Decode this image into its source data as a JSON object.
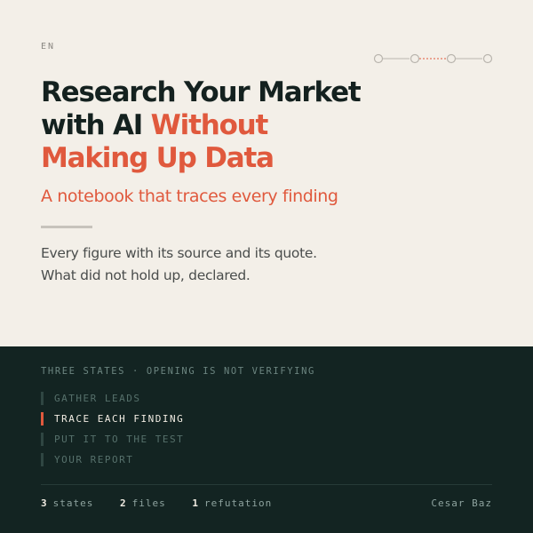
{
  "language": "EN",
  "title": {
    "line1": "Research Your Market",
    "line2_plain": "with AI ",
    "line2_accent": "Without",
    "line3_accent": "Making Up Data"
  },
  "subtitle": "A notebook that traces every finding",
  "description": {
    "line1": "Every figure with its source and its quote.",
    "line2": "What did not hold up, declared."
  },
  "progress": {
    "steps": 4,
    "current": 2
  },
  "section_heading": "THREE STATES · OPENING IS NOT VERIFYING",
  "states": [
    {
      "label": "GATHER LEADS",
      "active": false
    },
    {
      "label": "TRACE EACH FINDING",
      "active": true
    },
    {
      "label": "PUT IT TO THE TEST",
      "active": false
    },
    {
      "label": "YOUR REPORT",
      "active": false
    }
  ],
  "stats": [
    {
      "value": "3",
      "label": "states"
    },
    {
      "value": "2",
      "label": "files"
    },
    {
      "value": "1",
      "label": "refutation"
    }
  ],
  "author": "Cesar Baz",
  "colors": {
    "accent": "#e0593d",
    "background_light": "#f3efe8",
    "background_dark": "#132422",
    "ink": "#14211f"
  }
}
